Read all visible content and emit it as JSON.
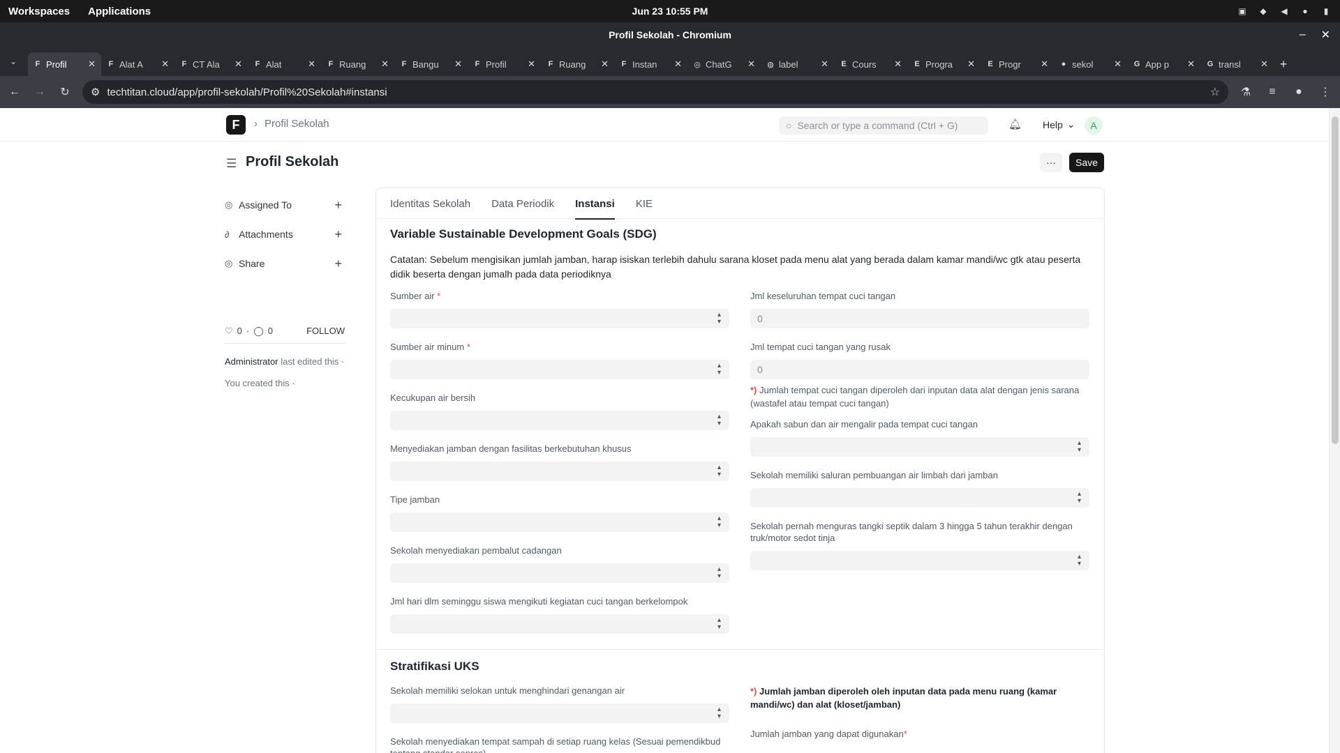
{
  "system": {
    "workspaces": "Workspaces",
    "applications": "Applications",
    "clock": "Jun 23  10:55 PM"
  },
  "window": {
    "title": "Profil Sekolah - Chromium"
  },
  "tabs": [
    {
      "label": "Profil",
      "active": true
    },
    {
      "label": "Alat A"
    },
    {
      "label": "CT Ala"
    },
    {
      "label": "Alat"
    },
    {
      "label": "Ruang"
    },
    {
      "label": "Bangu"
    },
    {
      "label": "Profil"
    },
    {
      "label": "Ruang"
    },
    {
      "label": "Instan"
    },
    {
      "label": "ChatG"
    },
    {
      "label": "label"
    },
    {
      "label": "Cours"
    },
    {
      "label": "Progra"
    },
    {
      "label": "Progr"
    },
    {
      "label": "sekol"
    },
    {
      "label": "App p"
    },
    {
      "label": "transl"
    }
  ],
  "address": {
    "url": "techtitan.cloud/app/profil-sekolah/Profil%20Sekolah#instansi"
  },
  "navbar": {
    "breadcrumb": "Profil Sekolah",
    "search_placeholder": "Search or type a command (Ctrl + G)",
    "help": "Help",
    "avatar_letter": "A"
  },
  "page": {
    "title": "Profil Sekolah",
    "more": "···",
    "save": "Save"
  },
  "sidebar": {
    "assigned_to": "Assigned To",
    "attachments": "Attachments",
    "share": "Share",
    "likes": "0",
    "comments": "0",
    "follow": "FOLLOW",
    "edited_user": "Administrator",
    "edited_text": "last edited this ·",
    "created": "You created this ·"
  },
  "form": {
    "tabs": [
      "Identitas Sekolah",
      "Data Periodik",
      "Instansi",
      "KIE"
    ],
    "active_tab": "Instansi",
    "sdg": {
      "title": "Variable Sustainable Development Goals (SDG)",
      "note": "Catatan: Sebelum mengisikan jumlah jamban, harap isiskan terlebih dahulu sarana kloset pada menu alat yang berada dalam kamar mandi/wc gtk atau peserta didik beserta dengan jumalh pada data periodiknya",
      "left": [
        {
          "label": "Sumber air",
          "required": "*"
        },
        {
          "label": "Sumber air minum",
          "required": "*"
        },
        {
          "label": "Kecukupan air bersih"
        },
        {
          "label": "Menyediakan jamban dengan fasilitas berkebutuhan khusus"
        },
        {
          "label": "Tipe jamban"
        },
        {
          "label": "Sekolah menyediakan pembalut cadangan"
        },
        {
          "label": "Jml hari dlm seminggu siswa mengikuti kegiatan cuci tangan berkelompok"
        }
      ],
      "right": {
        "total_label": "Jml keseluruhan tempat cuci tangan",
        "total_value": "0",
        "broken_label": "Jml tempat cuci tangan yang rusak",
        "broken_value": "0",
        "hint_star": "*)",
        "hint_text": "Jumlah tempat cuci tangan diperoleh dari inputan data alat dengan jenis sarana (wastafel atau tempat cuci tangan)",
        "soap_label": "Apakah sabun dan air mengalir pada tempat cuci tangan",
        "sewer_label": "Sekolah memiliki saluran pembuangan air limbah dari jamban",
        "septic_label": "Sekolah pernah menguras tangki septik dalam 3 hingga 5 tahun terakhir dengan truk/motor sedot tinja"
      }
    },
    "uks": {
      "title": "Stratifikasi UKS",
      "left": [
        {
          "label": "Sekolah memiliki selokan untuk menghindari genangan air"
        },
        {
          "label": "Sekolah menyediakan tempat sampah di setiap ruang kelas (Sesuai pemendikbud tentang standar sapras)"
        }
      ],
      "hint_star": "*)",
      "hint_text": "Jumlah jamban diperoleh oleh inputan data pada menu ruang (kamar mandi/wc) dan alat (kloset/jamban)",
      "usable_label": "Jumlah jamban yang dapat digunakan",
      "usable_required": "*"
    }
  }
}
